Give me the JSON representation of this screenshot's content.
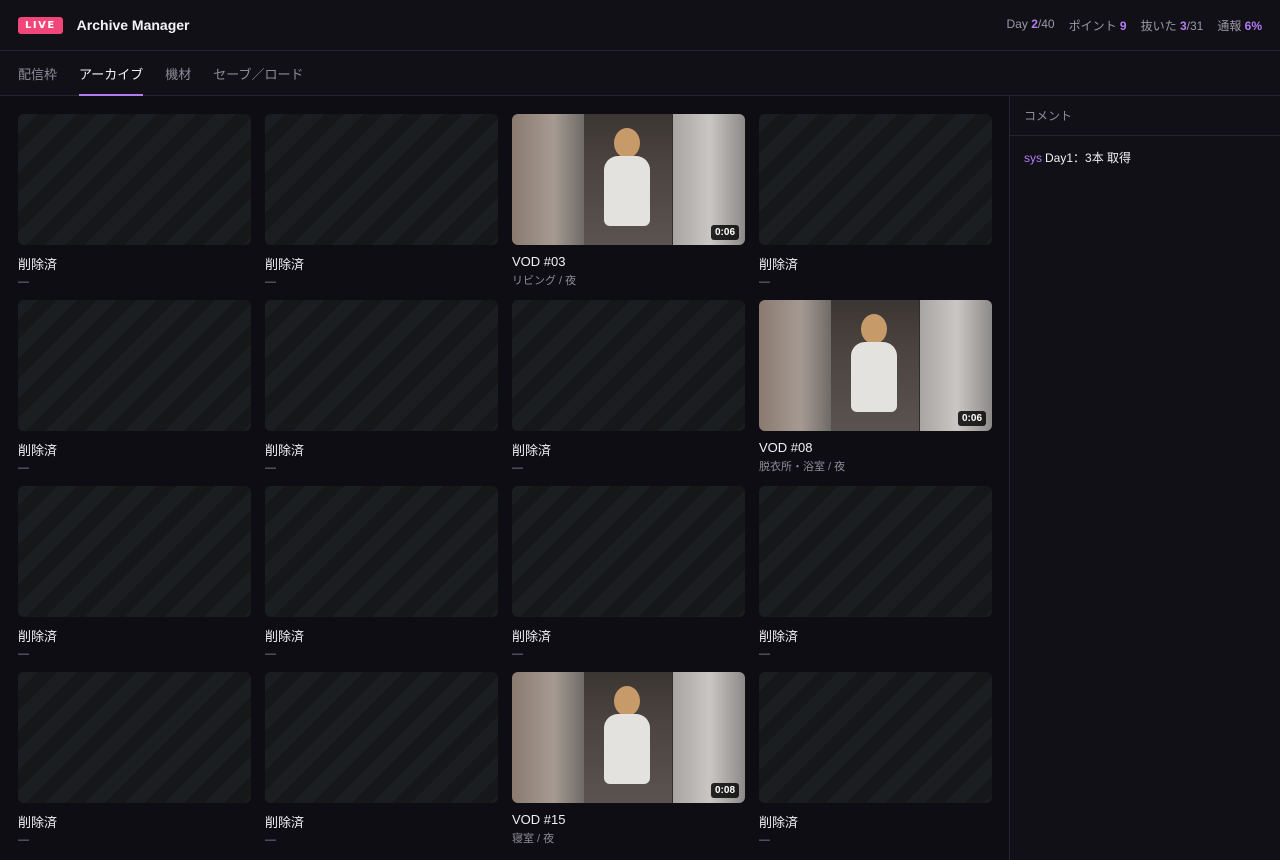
{
  "header": {
    "badge": "LIVE",
    "title": "Archive Manager",
    "stats": [
      {
        "label": "Day ",
        "value": "2",
        "suffix": "/40"
      },
      {
        "label": "ポイント ",
        "value": "9",
        "suffix": ""
      },
      {
        "label": "抜いた ",
        "value": "3",
        "suffix": "/31"
      },
      {
        "label": "通報 ",
        "value": "6%",
        "suffix": ""
      }
    ]
  },
  "tabs": [
    {
      "label": "配信枠",
      "active": false
    },
    {
      "label": "アーカイブ",
      "active": true
    },
    {
      "label": "機材",
      "active": false
    },
    {
      "label": "セーブ／ロード",
      "active": false
    }
  ],
  "archive": {
    "items": [
      {
        "title": "削除済",
        "sub": "—",
        "deleted": true
      },
      {
        "title": "削除済",
        "sub": "—",
        "deleted": true
      },
      {
        "title": "VOD #03",
        "sub": "リビング / 夜",
        "duration": "0:06",
        "deleted": false
      },
      {
        "title": "削除済",
        "sub": "—",
        "deleted": true
      },
      {
        "title": "削除済",
        "sub": "—",
        "deleted": true
      },
      {
        "title": "削除済",
        "sub": "—",
        "deleted": true
      },
      {
        "title": "削除済",
        "sub": "—",
        "deleted": true
      },
      {
        "title": "VOD #08",
        "sub": "脱衣所・浴室 / 夜",
        "duration": "0:06",
        "deleted": false
      },
      {
        "title": "削除済",
        "sub": "—",
        "deleted": true
      },
      {
        "title": "削除済",
        "sub": "—",
        "deleted": true
      },
      {
        "title": "削除済",
        "sub": "—",
        "deleted": true
      },
      {
        "title": "削除済",
        "sub": "—",
        "deleted": true
      },
      {
        "title": "削除済",
        "sub": "—",
        "deleted": true
      },
      {
        "title": "削除済",
        "sub": "—",
        "deleted": true
      },
      {
        "title": "VOD #15",
        "sub": "寝室 / 夜",
        "duration": "0:08",
        "deleted": false
      },
      {
        "title": "削除済",
        "sub": "—",
        "deleted": true
      }
    ]
  },
  "sidebar": {
    "header": "コメント",
    "comments": [
      {
        "author": "sys",
        "text": "Day1：3本 取得"
      }
    ]
  }
}
